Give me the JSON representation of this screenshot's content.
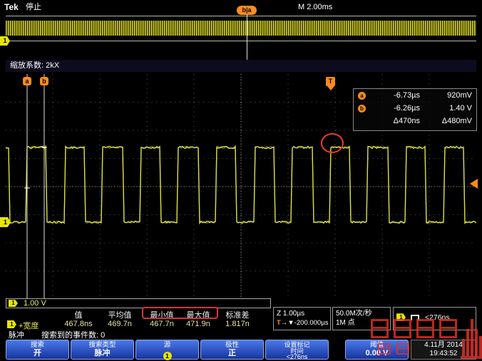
{
  "header": {
    "brand": "Tek",
    "acq_status": "停止",
    "timebase": "M 2.00ms",
    "zoom_window_tag": "b|a"
  },
  "overview": {
    "channel_badge": "1"
  },
  "zoom_bar": {
    "label": "缩放系数: 2kX"
  },
  "cursor_readout": {
    "a_label": "a",
    "b_label": "b",
    "a_time": "-6.73µs",
    "a_volt": "920mV",
    "b_time": "-6.26µs",
    "b_volt": "1.40 V",
    "delta_time": "Δ470ns",
    "delta_volt": "Δ480mV"
  },
  "trigger_marker_label": "T",
  "channel_scale": {
    "badge": "1",
    "scale": "1.00 V"
  },
  "measurements": {
    "headers": [
      "值",
      "平均值",
      "最小值",
      "最大值",
      "标准差"
    ],
    "row": {
      "channel": "1",
      "name": "+宽度",
      "values": [
        "467.8ns",
        "469.7n",
        "467.7n",
        "471.9n",
        "1.817n"
      ]
    }
  },
  "horizontal_readout": {
    "zoom_scale": "Z 1.00µs",
    "trigger_prefix": "T",
    "trigger_position": "→▼-200.000µs"
  },
  "acquisition_readout": {
    "sample_rate": "50.0M次/秒",
    "record_length": "1M 点"
  },
  "trigger_readout": {
    "channel": "1",
    "condition": "<276ns"
  },
  "search_status": {
    "mode": "脉冲",
    "events_text": "搜索到的事件数: 0"
  },
  "menu": {
    "buttons": [
      {
        "title": "搜索",
        "value": "开"
      },
      {
        "title": "搜索类型",
        "value": "脉冲"
      },
      {
        "title": "源",
        "value": "1"
      },
      {
        "title": "极性",
        "value": "正"
      },
      {
        "title": "设置标记",
        "value": "时间",
        "value2": "<276ns"
      },
      {
        "title": "阈值",
        "value": "0.00 V"
      }
    ]
  },
  "datetime": {
    "date": "4.11月 2014",
    "time": "19:43:52"
  },
  "waveform": {
    "type": "square",
    "cycles_visible": 12,
    "duty_cycle": 0.54,
    "channel_color": "#e3e34a"
  },
  "colors": {
    "channel1": "#e6e600",
    "marker_orange": "#ff8c1a",
    "menu_blue": "#1c46c8",
    "alert_red": "#e03030"
  }
}
